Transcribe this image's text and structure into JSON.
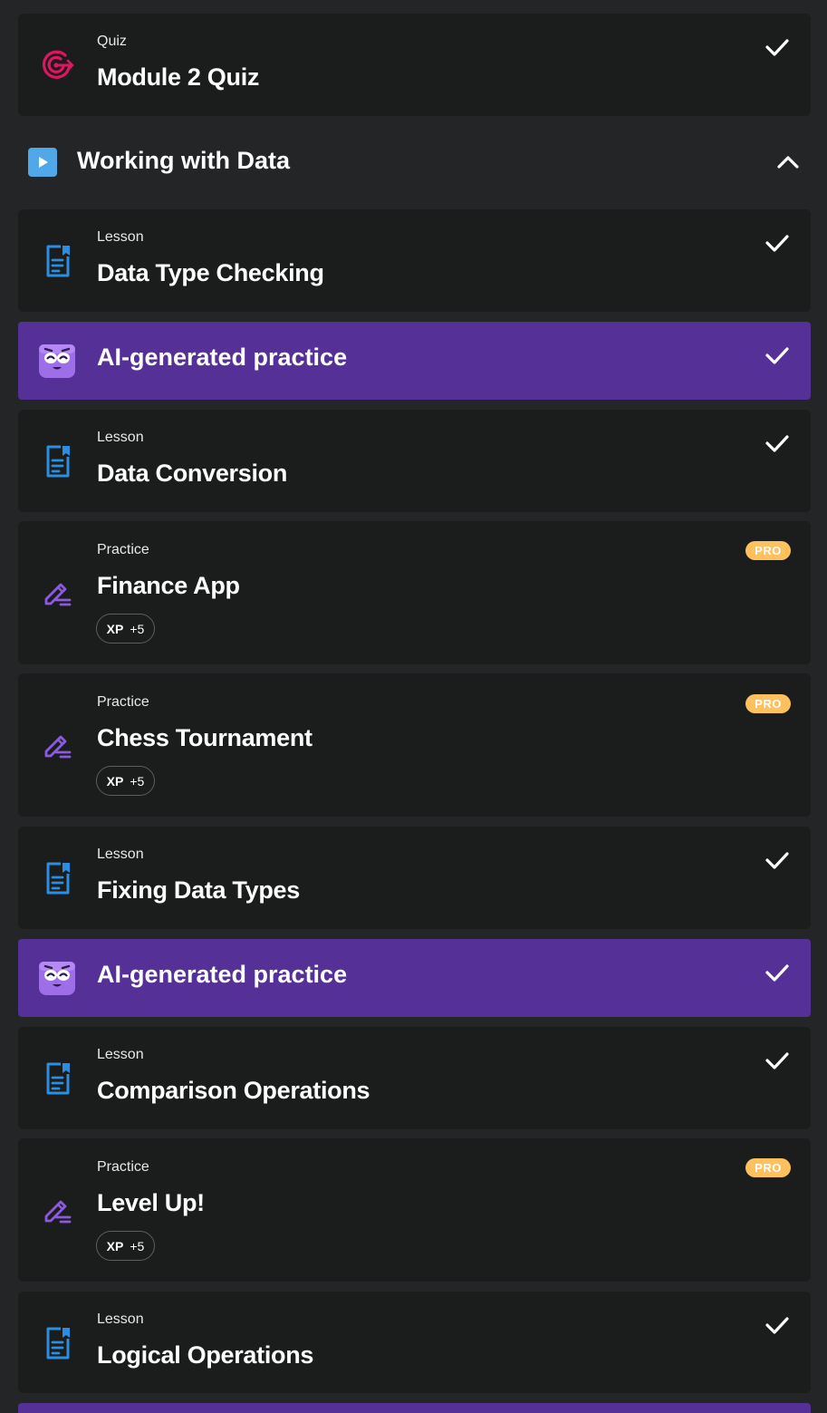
{
  "quiz": {
    "kind": "Quiz",
    "title": "Module 2 Quiz"
  },
  "section": {
    "title": "Working with Data"
  },
  "items": [
    {
      "kind": "Lesson",
      "title": "Data Type Checking"
    },
    {
      "ai_title": "AI-generated practice"
    },
    {
      "kind": "Lesson",
      "title": "Data Conversion"
    },
    {
      "kind": "Practice",
      "title": "Finance App",
      "badge": "PRO",
      "xp_label": "XP",
      "xp_value": "+5"
    },
    {
      "kind": "Practice",
      "title": "Chess Tournament",
      "badge": "PRO",
      "xp_label": "XP",
      "xp_value": "+5"
    },
    {
      "kind": "Lesson",
      "title": "Fixing Data Types"
    },
    {
      "ai_title": "AI-generated practice"
    },
    {
      "kind": "Lesson",
      "title": "Comparison Operations"
    },
    {
      "kind": "Practice",
      "title": "Level Up!",
      "badge": "PRO",
      "xp_label": "XP",
      "xp_value": "+5"
    },
    {
      "kind": "Lesson",
      "title": "Logical Operations"
    }
  ],
  "colors": {
    "background": "#232526",
    "card": "#1b1c1c",
    "ai_purple": "#553096",
    "lesson_blue": "#2a8fe0",
    "practice_purple": "#8c5ae0",
    "quiz_pink": "#e0155f",
    "pro_badge": "#ffc15e"
  },
  "icons": {
    "quiz": "target-icon",
    "lesson": "document-bookmark-icon",
    "practice": "pencil-edit-icon",
    "ai": "robot-mascot-icon",
    "done": "check-icon",
    "section": "play-icon",
    "collapse": "chevron-up-icon"
  }
}
